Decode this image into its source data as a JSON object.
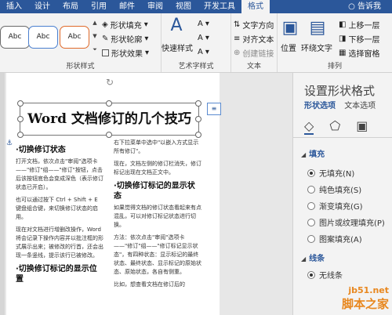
{
  "tabs": [
    "插入",
    "设计",
    "布局",
    "引用",
    "邮件",
    "审阅",
    "视图",
    "开发工具",
    "格式"
  ],
  "help": "告诉我",
  "ribbon": {
    "shape_styles": {
      "presets": [
        "Abc",
        "Abc",
        "Abc"
      ],
      "fill": "形状填充",
      "outline": "形状轮廓",
      "effects": "形状效果",
      "label": "形状样式"
    },
    "art_text": {
      "quick_styles": "快速样式",
      "label": "艺术字样式"
    },
    "text": {
      "direction": "文字方向",
      "align": "对齐文本",
      "link": "创建链接",
      "label": "文本"
    },
    "arrange": {
      "position": "位置",
      "wrap": "环绕文字",
      "forward": "上移一层",
      "backward": "下移一层",
      "pane": "选择窗格",
      "label": "排列"
    }
  },
  "doc": {
    "title": "Word 文档修订的几个技巧",
    "left_col": {
      "h1": "·切换修订状态",
      "p1": "打开文档，依次点击\"审阅\"选项卡——\"修订\"组——\"修订\"按钮，点击后该按钮底色会变成深色（表示修订状态已开启）。",
      "p2": "也可以通过按下 Ctrl + Shift + E 键盘组合键，来切换修订状态的启用。",
      "p3": "现在对文档进行增删改操作，Word 将会记录下操作内容并以批注框的形式展示出来；被修改的行首，还会出现一条竖线，提示该行已被修改。",
      "h2": "·切换修订标记的显示位置"
    },
    "right_col": {
      "p1": "右下拉菜单中选中\"以嵌入方式显示所有修订\"。",
      "p2": "现在，文档左侧的修订栏消失，修订标记出现在文档正文中。",
      "h1": "·切换修订标记的显示状态",
      "p3": "如果觉得文档的修订状态看起来有点混乱，可以对修订标记状态进行切换。",
      "p4": "方法：依次点击\"审阅\"选项卡——\"修订\"组——\"修订标记显示状态\"，有四种状态：显示标记的最终状态、最终状态、显示标记的原始状态、原始状态，各自有侧重。",
      "p5": "比如，想查看文档在修订后的"
    }
  },
  "pane": {
    "title": "设置形状格式",
    "tab_shape": "形状选项",
    "tab_text": "文本选项",
    "fill_section": "填充",
    "fill_options": [
      "无填充(N)",
      "纯色填充(S)",
      "渐变填充(G)",
      "图片或纹理填充(P)",
      "图案填充(A)"
    ],
    "line_section": "线条",
    "line_first": "无线条"
  },
  "watermark": {
    "site": "jb51.net",
    "name": "脚本之家"
  },
  "colors": {
    "accent": "#2b579a",
    "watermark": "#e8871e"
  }
}
